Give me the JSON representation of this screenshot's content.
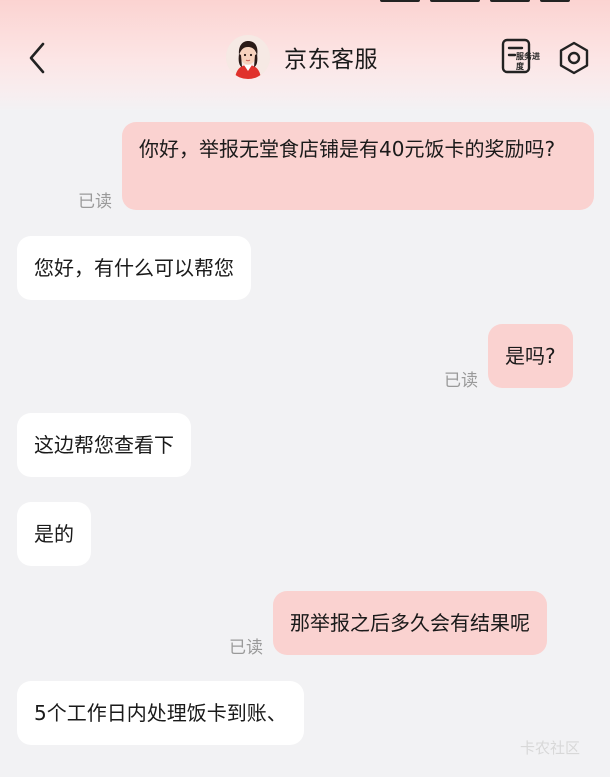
{
  "header": {
    "title": "京东客服",
    "service_progress_label": "服务进度",
    "icons": {
      "back": "chevron-left-icon",
      "avatar": "agent-avatar",
      "service_progress": "document-list-icon",
      "settings": "hexagon-settings-icon"
    }
  },
  "messages": [
    {
      "sender": "me",
      "text": "你好，举报无堂食店铺是有40元饭卡的奖励吗?",
      "status": "已读"
    },
    {
      "sender": "agent",
      "text": "您好，有什么可以帮您"
    },
    {
      "sender": "me",
      "text": "是吗?",
      "status": "已读"
    },
    {
      "sender": "agent",
      "text": "这边帮您查看下"
    },
    {
      "sender": "agent",
      "text": "是的"
    },
    {
      "sender": "me",
      "text": "那举报之后多久会有结果呢",
      "status": "已读"
    },
    {
      "sender": "agent",
      "text": "5个工作日内处理饭卡到账、"
    }
  ],
  "watermark": "卡农社区",
  "colors": {
    "my_bubble": "#fad2d0",
    "agent_bubble": "#ffffff",
    "background": "#f2f2f4",
    "header_top": "#fbd3d1"
  }
}
